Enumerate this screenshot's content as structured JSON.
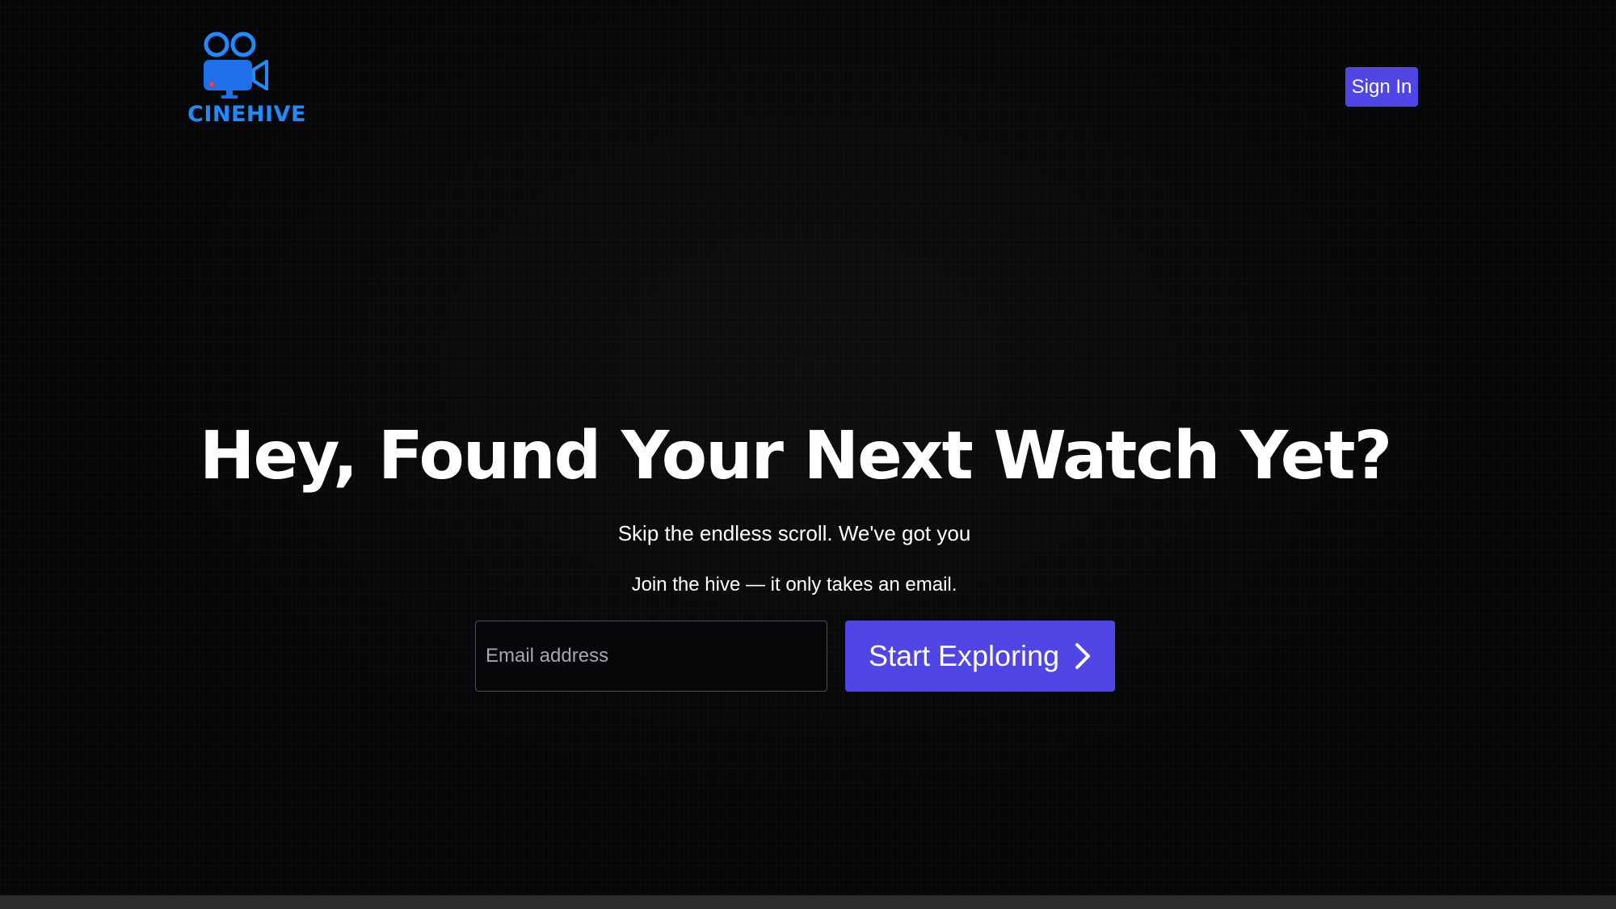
{
  "brand": {
    "name": "CINEHIVE",
    "logo_icon": "movie-camera-icon",
    "color": "#1f8bff"
  },
  "header": {
    "signin_label": "Sign In"
  },
  "hero": {
    "title": "Hey, Found Your Next Watch Yet?",
    "subtitle": "Skip the endless scroll. We've got you",
    "cta_text": "Join the hive — it only takes an email."
  },
  "form": {
    "email_placeholder": "Email address",
    "email_value": "",
    "submit_label": "Start Exploring",
    "submit_icon": "chevron-right-icon"
  },
  "colors": {
    "accent": "#4f46e5",
    "background": "#050607"
  }
}
